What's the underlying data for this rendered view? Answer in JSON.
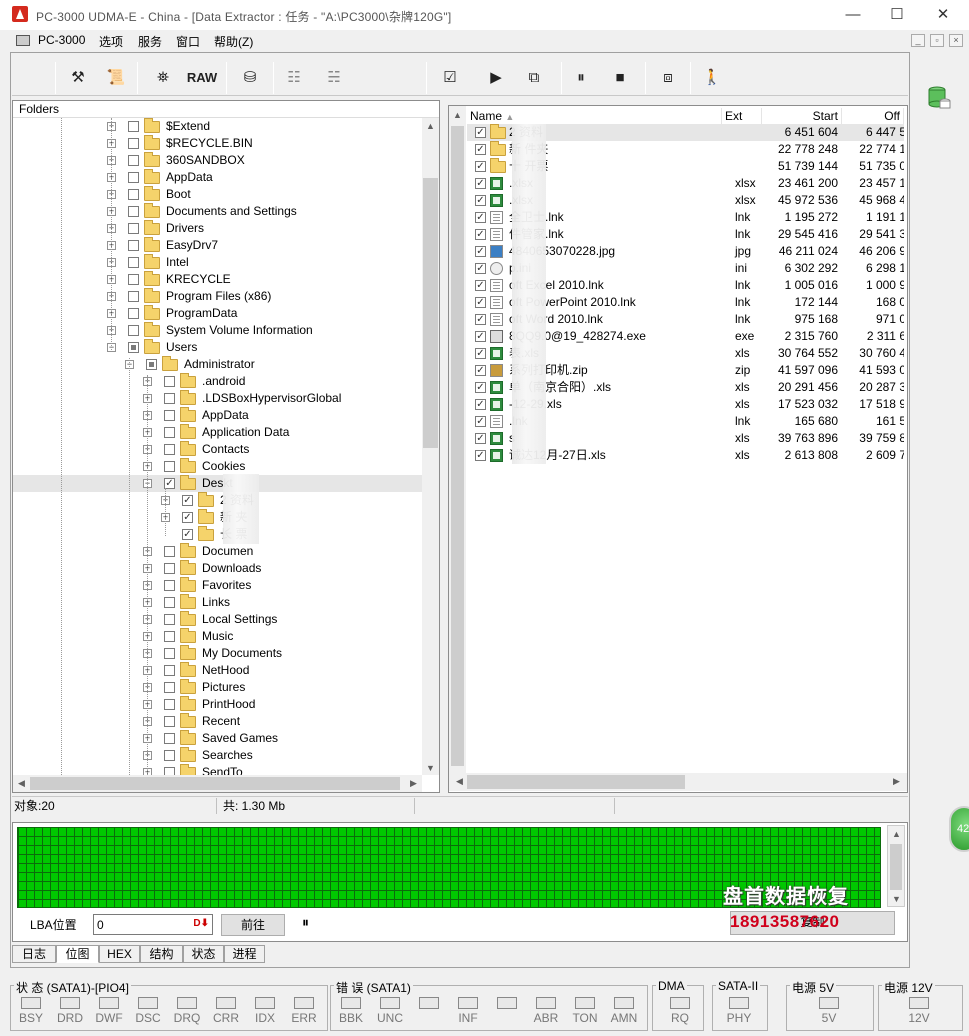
{
  "window": {
    "title": "PC-3000 UDMA-E - China - [Data Extractor : 任务 - \"A:\\PC3000\\杂牌120G\"]",
    "min": "—",
    "max": "☐",
    "close": "✕"
  },
  "menu": {
    "items": [
      "PC-3000",
      "选项",
      "服务",
      "窗口",
      "帮助(Z)"
    ]
  },
  "toolbar": {
    "raw": "RAW"
  },
  "tree": {
    "header": "Folders",
    "rows": [
      {
        "label": "$Extend",
        "lvl": 0,
        "exp": "+",
        "cb": ""
      },
      {
        "label": "$RECYCLE.BIN",
        "lvl": 0,
        "exp": "+",
        "cb": ""
      },
      {
        "label": "360SANDBOX",
        "lvl": 0,
        "exp": "+",
        "cb": ""
      },
      {
        "label": "AppData",
        "lvl": 0,
        "exp": "+",
        "cb": ""
      },
      {
        "label": "Boot",
        "lvl": 0,
        "exp": "+",
        "cb": ""
      },
      {
        "label": "Documents and Settings",
        "lvl": 0,
        "exp": "+",
        "cb": ""
      },
      {
        "label": "Drivers",
        "lvl": 0,
        "exp": "+",
        "cb": ""
      },
      {
        "label": "EasyDrv7",
        "lvl": 0,
        "exp": "+",
        "cb": ""
      },
      {
        "label": "Intel",
        "lvl": 0,
        "exp": "+",
        "cb": ""
      },
      {
        "label": "KRECYCLE",
        "lvl": 0,
        "exp": "+",
        "cb": ""
      },
      {
        "label": "Program Files (x86)",
        "lvl": 0,
        "exp": "+",
        "cb": ""
      },
      {
        "label": "ProgramData",
        "lvl": 0,
        "exp": "+",
        "cb": ""
      },
      {
        "label": "System Volume Information",
        "lvl": 0,
        "exp": "+",
        "cb": ""
      },
      {
        "label": "Users",
        "lvl": 0,
        "exp": "-",
        "cb": "part"
      },
      {
        "label": "Administrator",
        "lvl": 1,
        "exp": "-",
        "cb": "part"
      },
      {
        "label": ".android",
        "lvl": 2,
        "exp": "+",
        "cb": ""
      },
      {
        "label": ".LDSBoxHypervisorGlobal",
        "lvl": 2,
        "exp": "+",
        "cb": ""
      },
      {
        "label": "AppData",
        "lvl": 2,
        "exp": "+",
        "cb": ""
      },
      {
        "label": "Application Data",
        "lvl": 2,
        "exp": "+",
        "cb": ""
      },
      {
        "label": "Contacts",
        "lvl": 2,
        "exp": "+",
        "cb": ""
      },
      {
        "label": "Cookies",
        "lvl": 2,
        "exp": "+",
        "cb": ""
      },
      {
        "label": "Deskt",
        "lvl": 2,
        "exp": "-",
        "cb": "✓",
        "sel": true
      },
      {
        "label": "2     资料",
        "lvl": 3,
        "exp": "+",
        "cb": "✓"
      },
      {
        "label": "新      夹",
        "lvl": 3,
        "exp": "+",
        "cb": "✓"
      },
      {
        "label": "长      票",
        "lvl": 3,
        "exp": "",
        "cb": "✓"
      },
      {
        "label": "Documen",
        "lvl": 2,
        "exp": "+",
        "cb": ""
      },
      {
        "label": "Downloads",
        "lvl": 2,
        "exp": "+",
        "cb": ""
      },
      {
        "label": "Favorites",
        "lvl": 2,
        "exp": "+",
        "cb": ""
      },
      {
        "label": "Links",
        "lvl": 2,
        "exp": "+",
        "cb": ""
      },
      {
        "label": "Local Settings",
        "lvl": 2,
        "exp": "+",
        "cb": ""
      },
      {
        "label": "Music",
        "lvl": 2,
        "exp": "+",
        "cb": ""
      },
      {
        "label": "My Documents",
        "lvl": 2,
        "exp": "+",
        "cb": ""
      },
      {
        "label": "NetHood",
        "lvl": 2,
        "exp": "+",
        "cb": ""
      },
      {
        "label": "Pictures",
        "lvl": 2,
        "exp": "+",
        "cb": ""
      },
      {
        "label": "PrintHood",
        "lvl": 2,
        "exp": "+",
        "cb": ""
      },
      {
        "label": "Recent",
        "lvl": 2,
        "exp": "+",
        "cb": ""
      },
      {
        "label": "Saved Games",
        "lvl": 2,
        "exp": "+",
        "cb": ""
      },
      {
        "label": "Searches",
        "lvl": 2,
        "exp": "+",
        "cb": ""
      },
      {
        "label": "SendTo",
        "lvl": 2,
        "exp": "+",
        "cb": ""
      }
    ]
  },
  "list": {
    "columns": {
      "name": "Name",
      "ext": "Ext",
      "start": "Start",
      "off": "Off"
    },
    "rows": [
      {
        "icon": "folder",
        "name": "2      资料",
        "ext": "",
        "start": "6 451 604",
        "off": "6 447 5",
        "sel": true
      },
      {
        "icon": "folder",
        "name": "新      件夹",
        "ext": "",
        "start": "22 778 248",
        "off": "22 774 1"
      },
      {
        "icon": "folder",
        "name": "十      开票",
        "ext": "",
        "start": "51 739 144",
        "off": "51 735 0"
      },
      {
        "icon": "xl",
        "name": "      .xlsx",
        "ext": "xlsx",
        "start": "23 461 200",
        "off": "23 457 1"
      },
      {
        "icon": "xl",
        "name": "      .xlsx",
        "ext": "xlsx",
        "start": "45 972 536",
        "off": "45 968 4"
      },
      {
        "icon": "lnk",
        "name": "      全卫士.lnk",
        "ext": "lnk",
        "start": "1 195 272",
        "off": "1 191 1"
      },
      {
        "icon": "lnk",
        "name": "      件管家.lnk",
        "ext": "lnk",
        "start": "29 545 416",
        "off": "29 541 3"
      },
      {
        "icon": "jpg",
        "name": "      4840653070228.jpg",
        "ext": "jpg",
        "start": "46 211 024",
        "off": "46 206 9"
      },
      {
        "icon": "ini",
        "name": "      p.ini",
        "ext": "ini",
        "start": "6 302 292",
        "off": "6 298 1"
      },
      {
        "icon": "lnk",
        "name": "      oft Excel 2010.lnk",
        "ext": "lnk",
        "start": "1 005 016",
        "off": "1 000 9"
      },
      {
        "icon": "lnk",
        "name": "      oft PowerPoint 2010.lnk",
        "ext": "lnk",
        "start": "172 144",
        "off": "168 0"
      },
      {
        "icon": "lnk",
        "name": "      oft Word 2010.lnk",
        "ext": "lnk",
        "start": "975 168",
        "off": "971 0"
      },
      {
        "icon": "exe",
        "name": "      8QQ9.0@19_428274.exe",
        "ext": "exe",
        "start": "2 315 760",
        "off": "2 311 6"
      },
      {
        "icon": "xl",
        "name": "      表.xls",
        "ext": "xls",
        "start": "30 764 552",
        "off": "30 760 4"
      },
      {
        "icon": "zip",
        "name": "      系列打印机.zip",
        "ext": "zip",
        "start": "41 597 096",
        "off": "41 593 0"
      },
      {
        "icon": "xl",
        "name": "      单（南京合阳）.xls",
        "ext": "xls",
        "start": "20 291 456",
        "off": "20 287 3"
      },
      {
        "icon": "xl",
        "name": "      -12-29.xls",
        "ext": "xls",
        "start": "17 523 032",
        "off": "17 518 9"
      },
      {
        "icon": "lnk",
        "name": "      .lnk",
        "ext": "lnk",
        "start": "165 680",
        "off": "161 5"
      },
      {
        "icon": "xl",
        "name": "      s",
        "ext": "xls",
        "start": "39 763 896",
        "off": "39 759 8"
      },
      {
        "icon": "xl",
        "name": "      诚达12月-27日.xls",
        "ext": "xls",
        "start": "2 613 808",
        "off": "2 609 7"
      }
    ]
  },
  "status": {
    "objects": "对象:20",
    "total": "共: 1.30 Mb"
  },
  "map": {
    "lba_label": "LBA位置",
    "lba_value": "0",
    "go_button": "前往",
    "pause": "⏸",
    "copy_button": "复制"
  },
  "tabs": [
    "日志",
    "位图",
    "HEX",
    "结构",
    "状态",
    "进程"
  ],
  "active_tab": "位图",
  "indicators": {
    "status_title": "状 态 (SATA1)-[PIO4]",
    "status_leds": [
      "BSY",
      "DRD",
      "DWF",
      "DSC",
      "DRQ",
      "CRR",
      "IDX",
      "ERR"
    ],
    "error_title": "错 误 (SATA1)",
    "error_leds": [
      "BBK",
      "UNC",
      "",
      "INF",
      "",
      "ABR",
      "TON",
      "AMN"
    ],
    "dma_title": "DMA",
    "dma_leds": [
      "RQ"
    ],
    "sata_title": "SATA-II",
    "sata_leds": [
      "PHY"
    ],
    "p5_title": "电源 5V",
    "p5_leds": [
      "5V"
    ],
    "p12_title": "电源 12V",
    "p12_leds": [
      "12V"
    ]
  },
  "overlay": {
    "watermark": "盘首数据恢复",
    "phone": "18913587620",
    "bubble": "42"
  }
}
